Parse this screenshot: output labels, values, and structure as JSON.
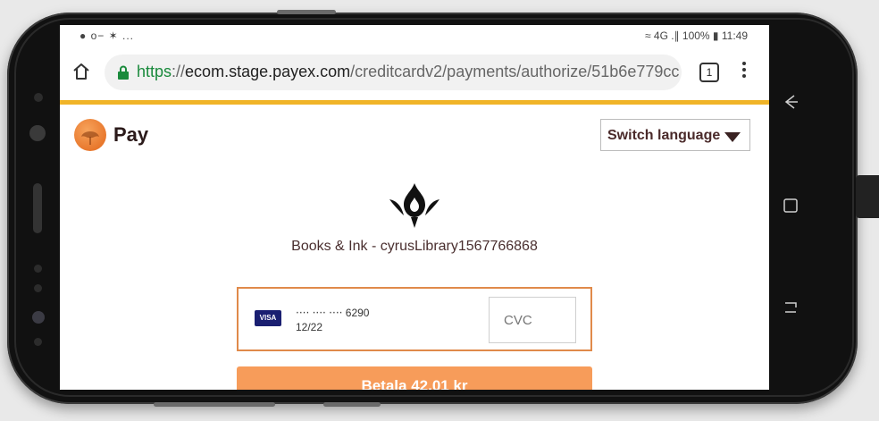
{
  "status_bar": {
    "left_icons": "● о− ✶ ...",
    "right_text": "≈ 4G .∥ 100% ▮ 11:49"
  },
  "browser": {
    "url_scheme": "https",
    "url_host_sep": "://",
    "url_domain": "ecom.stage.payex.com",
    "url_path": "/creditcardv2/payments/authorize/51b6e779cc",
    "tab_count": "1"
  },
  "page": {
    "brand_name": "Pay",
    "language_label": "Switch language",
    "merchant_name": "Books & Ink - cyrusLibrary1567766868",
    "card": {
      "brand": "VISA",
      "masked_number": "‧‧‧‧ ‧‧‧‧ ‧‧‧‧ 6290",
      "expiry": "12/22"
    },
    "cvc_placeholder": "CVC",
    "pay_button_label": "Betala 42,01 kr"
  },
  "colors": {
    "accent_bar": "#f0b428",
    "pay_button": "#f79c5a",
    "card_border": "#e08a4a",
    "https_green": "#1a8a3c"
  }
}
